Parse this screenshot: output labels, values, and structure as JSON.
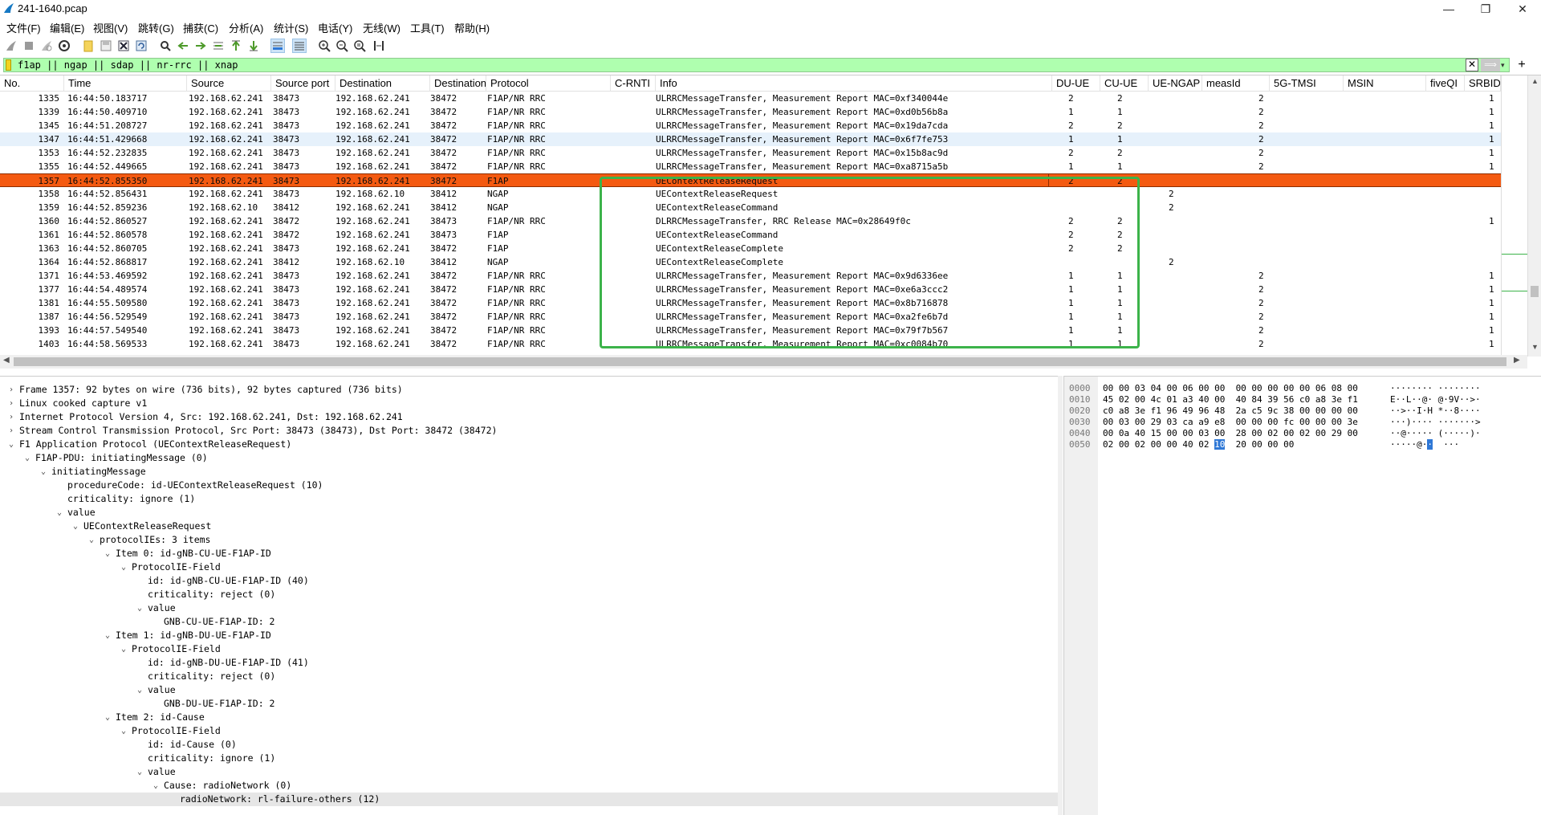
{
  "window": {
    "title": "241-1640.pcap",
    "minimize": "—",
    "maximize": "❐",
    "close": "✕"
  },
  "menu": [
    "文件(F)",
    "编辑(E)",
    "视图(V)",
    "跳转(G)",
    "捕获(C)",
    "分析(A)",
    "统计(S)",
    "电话(Y)",
    "无线(W)",
    "工具(T)",
    "帮助(H)"
  ],
  "toolbar": {
    "icons": [
      "shark-fin-start-icon",
      "stop-icon",
      "restart-icon",
      "options-gear-icon",
      "open-folder-icon",
      "save-file-icon",
      "close-file-icon",
      "reload-icon",
      "find-icon",
      "back-arrow-icon",
      "forward-arrow-icon",
      "go-to-packet-icon",
      "first-packet-icon",
      "last-packet-icon",
      "autoscroll-icon",
      "colorize-icon",
      "zoom-in-icon",
      "zoom-out-icon",
      "zoom-normal-icon",
      "resize-columns-icon"
    ]
  },
  "filter": {
    "value": "f1ap || ngap || sdap || nr-rrc || xnap",
    "clear": "✕",
    "apply": "⟹",
    "add": "+"
  },
  "packet_list": {
    "columns": [
      "No.",
      "Time",
      "Source",
      "Source port",
      "Destination",
      "Destination",
      "Protocol",
      "C-RNTI",
      "Info",
      "DU-UE",
      "CU-UE",
      "UE-NGAP",
      "measId",
      "5G-TMSI",
      "MSIN",
      "fiveQI",
      "SRBID"
    ],
    "rows": [
      {
        "no": "1335",
        "time": "16:44:50.183717",
        "src": "192.168.62.241",
        "sport": "38473",
        "dst": "192.168.62.241",
        "dport": "38472",
        "proto": "F1AP/NR RRC",
        "crnti": "",
        "info": "ULRRCMessageTransfer, Measurement Report MAC=0xf340044e",
        "du": "2",
        "cu": "2",
        "ngap": "",
        "meas": "2",
        "tmsi": "",
        "msin": "",
        "fiveqi": "",
        "srb": "1",
        "state": "normal"
      },
      {
        "no": "1339",
        "time": "16:44:50.409710",
        "src": "192.168.62.241",
        "sport": "38473",
        "dst": "192.168.62.241",
        "dport": "38472",
        "proto": "F1AP/NR RRC",
        "crnti": "",
        "info": "ULRRCMessageTransfer, Measurement Report MAC=0xd0b56b8a",
        "du": "1",
        "cu": "1",
        "ngap": "",
        "meas": "2",
        "tmsi": "",
        "msin": "",
        "fiveqi": "",
        "srb": "1",
        "state": "normal"
      },
      {
        "no": "1345",
        "time": "16:44:51.208727",
        "src": "192.168.62.241",
        "sport": "38473",
        "dst": "192.168.62.241",
        "dport": "38472",
        "proto": "F1AP/NR RRC",
        "crnti": "",
        "info": "ULRRCMessageTransfer, Measurement Report MAC=0x19da7cda",
        "du": "2",
        "cu": "2",
        "ngap": "",
        "meas": "2",
        "tmsi": "",
        "msin": "",
        "fiveqi": "",
        "srb": "1",
        "state": "normal"
      },
      {
        "no": "1347",
        "time": "16:44:51.429668",
        "src": "192.168.62.241",
        "sport": "38473",
        "dst": "192.168.62.241",
        "dport": "38472",
        "proto": "F1AP/NR RRC",
        "crnti": "",
        "info": "ULRRCMessageTransfer, Measurement Report MAC=0x6f7fe753",
        "du": "1",
        "cu": "1",
        "ngap": "",
        "meas": "2",
        "tmsi": "",
        "msin": "",
        "fiveqi": "",
        "srb": "1",
        "state": "marked"
      },
      {
        "no": "1353",
        "time": "16:44:52.232835",
        "src": "192.168.62.241",
        "sport": "38473",
        "dst": "192.168.62.241",
        "dport": "38472",
        "proto": "F1AP/NR RRC",
        "crnti": "",
        "info": "ULRRCMessageTransfer, Measurement Report MAC=0x15b8ac9d",
        "du": "2",
        "cu": "2",
        "ngap": "",
        "meas": "2",
        "tmsi": "",
        "msin": "",
        "fiveqi": "",
        "srb": "1",
        "state": "normal"
      },
      {
        "no": "1355",
        "time": "16:44:52.449665",
        "src": "192.168.62.241",
        "sport": "38473",
        "dst": "192.168.62.241",
        "dport": "38472",
        "proto": "F1AP/NR RRC",
        "crnti": "",
        "info": "ULRRCMessageTransfer, Measurement Report MAC=0xa8715a5b",
        "du": "1",
        "cu": "1",
        "ngap": "",
        "meas": "2",
        "tmsi": "",
        "msin": "",
        "fiveqi": "",
        "srb": "1",
        "state": "normal"
      },
      {
        "no": "1357",
        "time": "16:44:52.855350",
        "src": "192.168.62.241",
        "sport": "38473",
        "dst": "192.168.62.241",
        "dport": "38472",
        "proto": "F1AP",
        "crnti": "",
        "info": "UEContextReleaseRequest",
        "du": "2",
        "cu": "2",
        "ngap": "",
        "meas": "",
        "tmsi": "",
        "msin": "",
        "fiveqi": "",
        "srb": "",
        "state": "selected"
      },
      {
        "no": "1358",
        "time": "16:44:52.856431",
        "src": "192.168.62.241",
        "sport": "38473",
        "dst": "192.168.62.10",
        "dport": "38412",
        "proto": "NGAP",
        "crnti": "",
        "info": "UEContextReleaseRequest",
        "du": "",
        "cu": "",
        "ngap": "2",
        "meas": "",
        "tmsi": "",
        "msin": "",
        "fiveqi": "",
        "srb": "",
        "state": "normal"
      },
      {
        "no": "1359",
        "time": "16:44:52.859236",
        "src": "192.168.62.10",
        "sport": "38412",
        "dst": "192.168.62.241",
        "dport": "38412",
        "proto": "NGAP",
        "crnti": "",
        "info": "UEContextReleaseCommand",
        "du": "",
        "cu": "",
        "ngap": "2",
        "meas": "",
        "tmsi": "",
        "msin": "",
        "fiveqi": "",
        "srb": "",
        "state": "normal"
      },
      {
        "no": "1360",
        "time": "16:44:52.860527",
        "src": "192.168.62.241",
        "sport": "38472",
        "dst": "192.168.62.241",
        "dport": "38473",
        "proto": "F1AP/NR RRC",
        "crnti": "",
        "info": "DLRRCMessageTransfer, RRC Release MAC=0x28649f0c",
        "du": "2",
        "cu": "2",
        "ngap": "",
        "meas": "",
        "tmsi": "",
        "msin": "",
        "fiveqi": "",
        "srb": "1",
        "state": "normal"
      },
      {
        "no": "1361",
        "time": "16:44:52.860578",
        "src": "192.168.62.241",
        "sport": "38472",
        "dst": "192.168.62.241",
        "dport": "38473",
        "proto": "F1AP",
        "crnti": "",
        "info": "UEContextReleaseCommand",
        "du": "2",
        "cu": "2",
        "ngap": "",
        "meas": "",
        "tmsi": "",
        "msin": "",
        "fiveqi": "",
        "srb": "",
        "state": "normal"
      },
      {
        "no": "1363",
        "time": "16:44:52.860705",
        "src": "192.168.62.241",
        "sport": "38473",
        "dst": "192.168.62.241",
        "dport": "38472",
        "proto": "F1AP",
        "crnti": "",
        "info": "UEContextReleaseComplete",
        "du": "2",
        "cu": "2",
        "ngap": "",
        "meas": "",
        "tmsi": "",
        "msin": "",
        "fiveqi": "",
        "srb": "",
        "state": "normal"
      },
      {
        "no": "1364",
        "time": "16:44:52.868817",
        "src": "192.168.62.241",
        "sport": "38412",
        "dst": "192.168.62.10",
        "dport": "38412",
        "proto": "NGAP",
        "crnti": "",
        "info": "UEContextReleaseComplete",
        "du": "",
        "cu": "",
        "ngap": "2",
        "meas": "",
        "tmsi": "",
        "msin": "",
        "fiveqi": "",
        "srb": "",
        "state": "normal"
      },
      {
        "no": "1371",
        "time": "16:44:53.469592",
        "src": "192.168.62.241",
        "sport": "38473",
        "dst": "192.168.62.241",
        "dport": "38472",
        "proto": "F1AP/NR RRC",
        "crnti": "",
        "info": "ULRRCMessageTransfer, Measurement Report MAC=0x9d6336ee",
        "du": "1",
        "cu": "1",
        "ngap": "",
        "meas": "2",
        "tmsi": "",
        "msin": "",
        "fiveqi": "",
        "srb": "1",
        "state": "normal"
      },
      {
        "no": "1377",
        "time": "16:44:54.489574",
        "src": "192.168.62.241",
        "sport": "38473",
        "dst": "192.168.62.241",
        "dport": "38472",
        "proto": "F1AP/NR RRC",
        "crnti": "",
        "info": "ULRRCMessageTransfer, Measurement Report MAC=0xe6a3ccc2",
        "du": "1",
        "cu": "1",
        "ngap": "",
        "meas": "2",
        "tmsi": "",
        "msin": "",
        "fiveqi": "",
        "srb": "1",
        "state": "normal"
      },
      {
        "no": "1381",
        "time": "16:44:55.509580",
        "src": "192.168.62.241",
        "sport": "38473",
        "dst": "192.168.62.241",
        "dport": "38472",
        "proto": "F1AP/NR RRC",
        "crnti": "",
        "info": "ULRRCMessageTransfer, Measurement Report MAC=0x8b716878",
        "du": "1",
        "cu": "1",
        "ngap": "",
        "meas": "2",
        "tmsi": "",
        "msin": "",
        "fiveqi": "",
        "srb": "1",
        "state": "normal"
      },
      {
        "no": "1387",
        "time": "16:44:56.529549",
        "src": "192.168.62.241",
        "sport": "38473",
        "dst": "192.168.62.241",
        "dport": "38472",
        "proto": "F1AP/NR RRC",
        "crnti": "",
        "info": "ULRRCMessageTransfer, Measurement Report MAC=0xa2fe6b7d",
        "du": "1",
        "cu": "1",
        "ngap": "",
        "meas": "2",
        "tmsi": "",
        "msin": "",
        "fiveqi": "",
        "srb": "1",
        "state": "normal"
      },
      {
        "no": "1393",
        "time": "16:44:57.549540",
        "src": "192.168.62.241",
        "sport": "38473",
        "dst": "192.168.62.241",
        "dport": "38472",
        "proto": "F1AP/NR RRC",
        "crnti": "",
        "info": "ULRRCMessageTransfer, Measurement Report MAC=0x79f7b567",
        "du": "1",
        "cu": "1",
        "ngap": "",
        "meas": "2",
        "tmsi": "",
        "msin": "",
        "fiveqi": "",
        "srb": "1",
        "state": "normal"
      },
      {
        "no": "1403",
        "time": "16:44:58.569533",
        "src": "192.168.62.241",
        "sport": "38473",
        "dst": "192.168.62.241",
        "dport": "38472",
        "proto": "F1AP/NR RRC",
        "crnti": "",
        "info": "ULRRCMessageTransfer, Measurement Report MAC=0xc0084b70",
        "du": "1",
        "cu": "1",
        "ngap": "",
        "meas": "2",
        "tmsi": "",
        "msin": "",
        "fiveqi": "",
        "srb": "1",
        "state": "normal"
      }
    ]
  },
  "details": [
    {
      "indent": 0,
      "arrow": "›",
      "text": "Frame 1357: 92 bytes on wire (736 bits), 92 bytes captured (736 bits)"
    },
    {
      "indent": 0,
      "arrow": "›",
      "text": "Linux cooked capture v1"
    },
    {
      "indent": 0,
      "arrow": "›",
      "text": "Internet Protocol Version 4, Src: 192.168.62.241, Dst: 192.168.62.241"
    },
    {
      "indent": 0,
      "arrow": "›",
      "text": "Stream Control Transmission Protocol, Src Port: 38473 (38473), Dst Port: 38472 (38472)"
    },
    {
      "indent": 0,
      "arrow": "⌄",
      "text": "F1 Application Protocol (UEContextReleaseRequest)"
    },
    {
      "indent": 1,
      "arrow": "⌄",
      "text": "F1AP-PDU: initiatingMessage (0)"
    },
    {
      "indent": 2,
      "arrow": "⌄",
      "text": "initiatingMessage"
    },
    {
      "indent": 3,
      "arrow": "",
      "text": "procedureCode: id-UEContextReleaseRequest (10)"
    },
    {
      "indent": 3,
      "arrow": "",
      "text": "criticality: ignore (1)"
    },
    {
      "indent": 3,
      "arrow": "⌄",
      "text": "value"
    },
    {
      "indent": 4,
      "arrow": "⌄",
      "text": "UEContextReleaseRequest"
    },
    {
      "indent": 5,
      "arrow": "⌄",
      "text": "protocolIEs: 3 items"
    },
    {
      "indent": 6,
      "arrow": "⌄",
      "text": "Item 0: id-gNB-CU-UE-F1AP-ID"
    },
    {
      "indent": 7,
      "arrow": "⌄",
      "text": "ProtocolIE-Field"
    },
    {
      "indent": 8,
      "arrow": "",
      "text": "id: id-gNB-CU-UE-F1AP-ID (40)"
    },
    {
      "indent": 8,
      "arrow": "",
      "text": "criticality: reject (0)"
    },
    {
      "indent": 8,
      "arrow": "⌄",
      "text": "value"
    },
    {
      "indent": 9,
      "arrow": "",
      "text": "GNB-CU-UE-F1AP-ID: 2"
    },
    {
      "indent": 6,
      "arrow": "⌄",
      "text": "Item 1: id-gNB-DU-UE-F1AP-ID"
    },
    {
      "indent": 7,
      "arrow": "⌄",
      "text": "ProtocolIE-Field"
    },
    {
      "indent": 8,
      "arrow": "",
      "text": "id: id-gNB-DU-UE-F1AP-ID (41)"
    },
    {
      "indent": 8,
      "arrow": "",
      "text": "criticality: reject (0)"
    },
    {
      "indent": 8,
      "arrow": "⌄",
      "text": "value"
    },
    {
      "indent": 9,
      "arrow": "",
      "text": "GNB-DU-UE-F1AP-ID: 2"
    },
    {
      "indent": 6,
      "arrow": "⌄",
      "text": "Item 2: id-Cause"
    },
    {
      "indent": 7,
      "arrow": "⌄",
      "text": "ProtocolIE-Field"
    },
    {
      "indent": 8,
      "arrow": "",
      "text": "id: id-Cause (0)"
    },
    {
      "indent": 8,
      "arrow": "",
      "text": "criticality: ignore (1)"
    },
    {
      "indent": 8,
      "arrow": "⌄",
      "text": "value"
    },
    {
      "indent": 9,
      "arrow": "⌄",
      "text": "Cause: radioNetwork (0)"
    },
    {
      "indent": 10,
      "arrow": "",
      "text": "radioNetwork: rl-failure-others (12)",
      "highlight": true
    }
  ],
  "bytes": [
    {
      "offset": "0000",
      "hex": "00 00 03 04 00 06 00 00  00 00 00 00 00 06 08 00",
      "ascii": "········ ········"
    },
    {
      "offset": "0010",
      "hex": "45 02 00 4c 01 a3 40 00  40 84 39 56 c0 a8 3e f1",
      "ascii": "E··L··@· @·9V··>·"
    },
    {
      "offset": "0020",
      "hex": "c0 a8 3e f1 96 49 96 48  2a c5 9c 38 00 00 00 00",
      "ascii": "··>··I·H *··8····"
    },
    {
      "offset": "0030",
      "hex": "00 03 00 29 03 ca a9 e8  00 00 00 fc 00 00 00 3e",
      "ascii": "···)···· ·······>"
    },
    {
      "offset": "0040",
      "hex": "00 0a 40 15 00 00 03 00  28 00 02 00 02 00 29 00",
      "ascii": "··@····· (·····)·"
    },
    {
      "offset": "0050",
      "hex_before": "02 00 02 00 00 40 02 ",
      "hex_sel": "10",
      "hex_after": "  20 00 00 00",
      "ascii_before": "·····@·",
      "ascii_sel": "·",
      "ascii_after": "  ···"
    }
  ]
}
